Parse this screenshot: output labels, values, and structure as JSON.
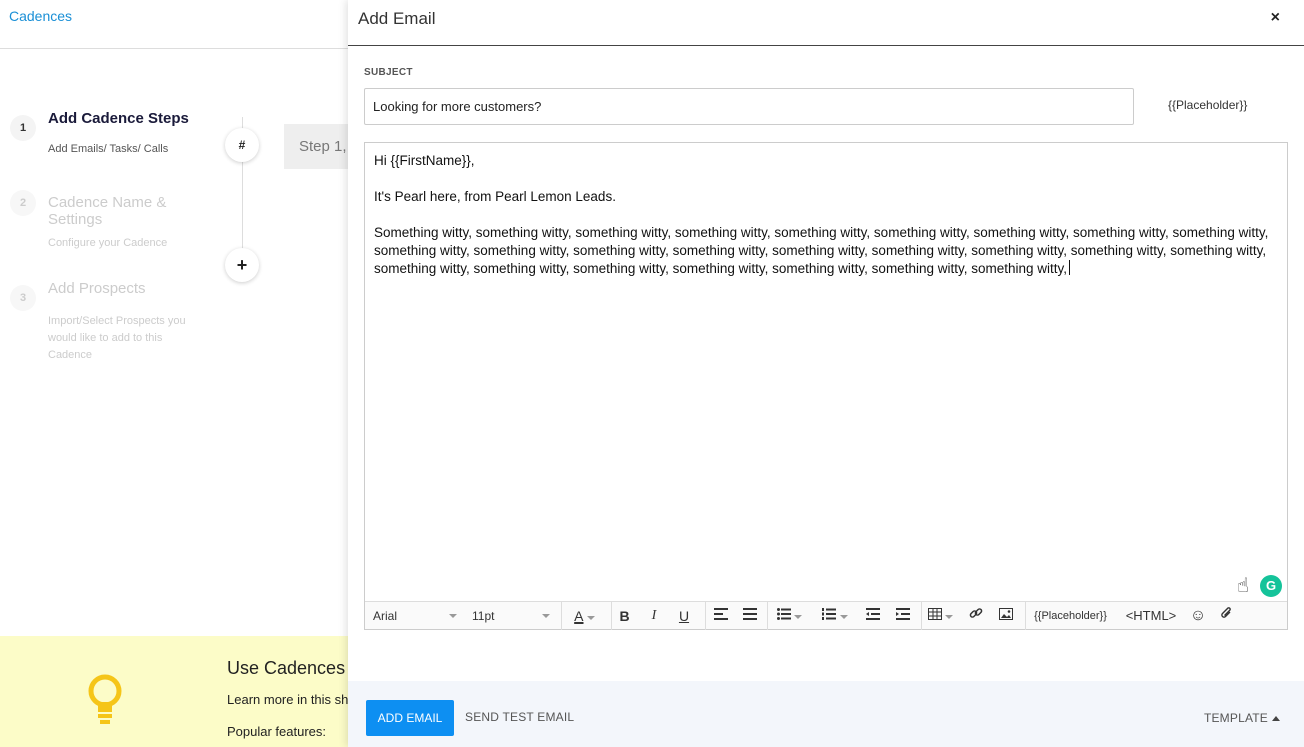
{
  "background": {
    "breadcrumb": "Cadences",
    "steps": [
      {
        "num": "1",
        "title": "Add Cadence Steps",
        "sub": "Add Emails/ Tasks/ Calls"
      },
      {
        "num": "2",
        "title": "Cadence Name & Settings",
        "sub": "Configure your Cadence"
      },
      {
        "num": "3",
        "title": "Add Prospects",
        "sub": "Import/Select Prospects you would like to add to this Cadence"
      }
    ],
    "hash_label": "#",
    "plus_label": "+",
    "step_box": "Step 1,",
    "banner": {
      "title": "Use Cadences t",
      "learn": "Learn more in this sh",
      "popular": "Popular features:"
    }
  },
  "modal": {
    "title": "Add Email",
    "close": "×",
    "subject_label": "SUBJECT",
    "subject_value": "Looking for more customers?",
    "placeholder_link": "{{Placeholder}}",
    "body": {
      "greeting": "Hi {{FirstName}},",
      "intro": "It's Pearl here, from Pearl Lemon Leads.",
      "paragraph": "Something witty, something witty, something witty, something witty, something witty, something witty, something witty, something witty, something witty, something witty, something witty, something witty, something witty, something witty, something witty, something witty, something witty, something witty, something witty, something witty, something witty, something witty, something witty, something witty, something witty,"
    },
    "toolbar": {
      "font": "Arial",
      "size": "11pt",
      "font_color": "A",
      "bold": "B",
      "italic": "I",
      "underline": "U",
      "placeholder": "{{Placeholder}}",
      "html": "<HTML>"
    },
    "footer": {
      "add_email": "ADD EMAIL",
      "send_test": "SEND TEST EMAIL",
      "template": "TEMPLATE"
    }
  },
  "colors": {
    "primary": "#0d8ff2",
    "link": "#1a8fd6",
    "banner": "#fcfcc8",
    "grammarly": "#15c39a"
  }
}
